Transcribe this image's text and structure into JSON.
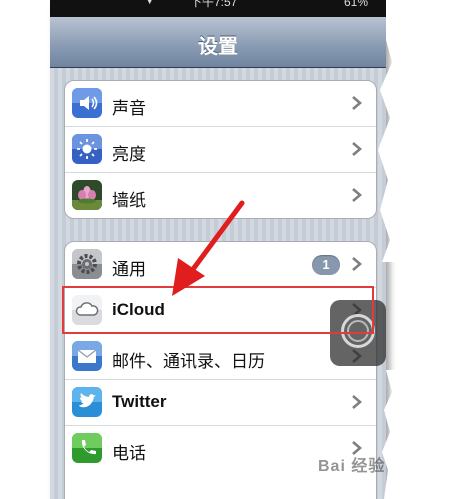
{
  "statusbar": {
    "signal": "᷍ ▼",
    "time": "下午7:57",
    "battery": "61%"
  },
  "navbar": {
    "title": "设置"
  },
  "group1": [
    {
      "label": "声音",
      "icon": "sound-icon"
    },
    {
      "label": "亮度",
      "icon": "brightness-icon"
    },
    {
      "label": "墙纸",
      "icon": "wallpaper-icon"
    }
  ],
  "group2": [
    {
      "label": "通用",
      "icon": "gear-icon",
      "badge": "1"
    },
    {
      "label": "iCloud",
      "icon": "icloud-icon"
    },
    {
      "label": "邮件、通讯录、日历",
      "icon": "mail-icon"
    },
    {
      "label": "Twitter",
      "icon": "twitter-icon"
    },
    {
      "label": "电话",
      "icon": "phone-icon"
    }
  ],
  "annotation": {
    "color": "#e23b3b"
  },
  "watermark": {
    "text": "Bai 经验"
  }
}
